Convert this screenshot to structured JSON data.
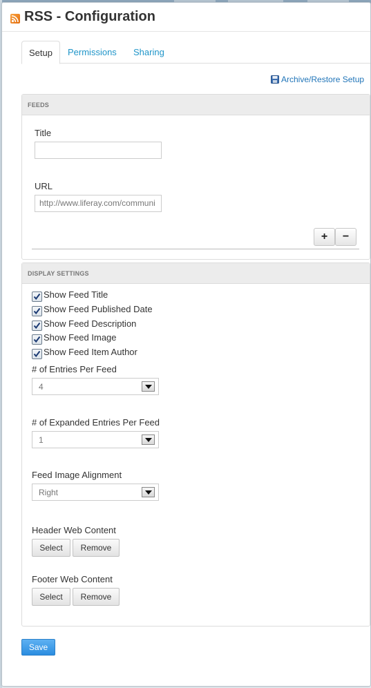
{
  "window": {
    "title": "RSS - Configuration",
    "icon": "rss-icon"
  },
  "tabs": [
    {
      "label": "Setup",
      "active": true
    },
    {
      "label": "Permissions",
      "active": false
    },
    {
      "label": "Sharing",
      "active": false
    }
  ],
  "archive_link": {
    "label": "Archive/Restore Setup",
    "icon": "save-disk-icon"
  },
  "feeds": {
    "header": "FEEDS",
    "title_label": "Title",
    "title_value": "",
    "url_label": "URL",
    "url_value": "http://www.liferay.com/communi",
    "add_label": "+",
    "remove_label": "−"
  },
  "display": {
    "header": "DISPLAY SETTINGS",
    "checkboxes": [
      {
        "label": "Show Feed Title",
        "checked": true
      },
      {
        "label": "Show Feed Published Date",
        "checked": true
      },
      {
        "label": "Show Feed Description",
        "checked": true
      },
      {
        "label": "Show Feed Image",
        "checked": true
      },
      {
        "label": "Show Feed Item Author",
        "checked": true
      }
    ],
    "entries_label": "# of Entries Per Feed",
    "entries_value": "4",
    "expanded_label": "# of Expanded Entries Per Feed",
    "expanded_value": "1",
    "alignment_label": "Feed Image Alignment",
    "alignment_value": "Right",
    "header_content_label": "Header Web Content",
    "footer_content_label": "Footer Web Content",
    "select_label": "Select",
    "remove_label": "Remove"
  },
  "save_label": "Save",
  "colors": {
    "link": "#1f95c9",
    "save_button": "#3b97e3",
    "panel_header": "#ececec"
  }
}
